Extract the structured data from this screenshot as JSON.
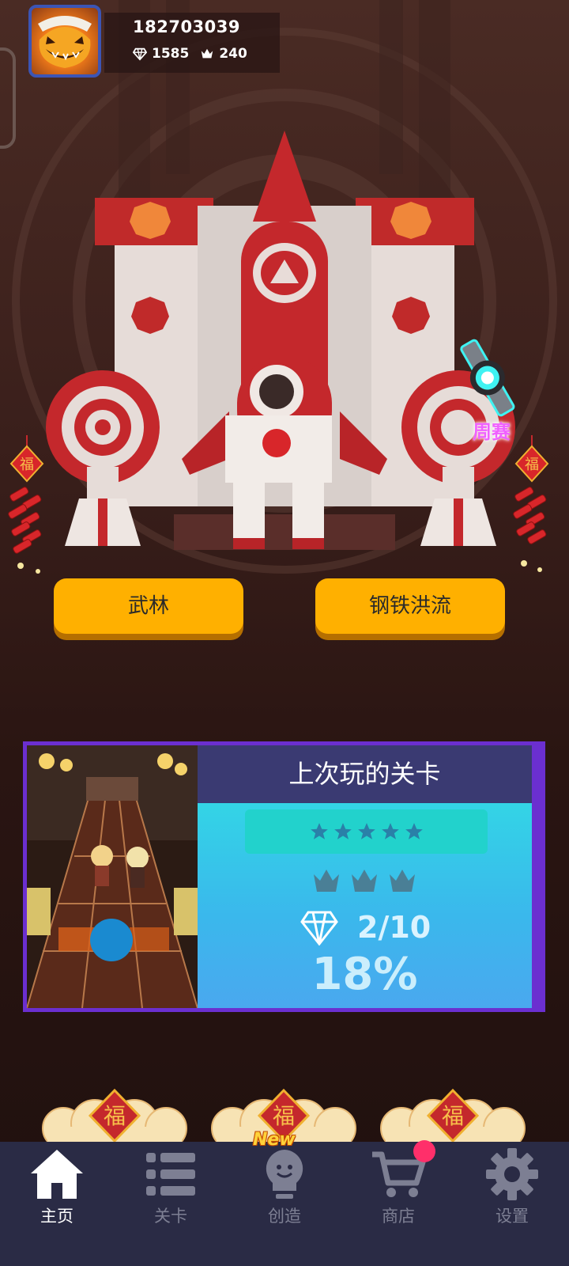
{
  "profile": {
    "user_id": "182703039",
    "diamonds": "1585",
    "crowns": "240",
    "avatar_icon": "pumpkin-avatar-icon"
  },
  "event": {
    "weekly_label": "周赛"
  },
  "modes": {
    "left_label": "武林",
    "right_label": "钢铁洪流"
  },
  "last_played": {
    "title": "上次玩的关卡",
    "stars_total": 5,
    "stars_earned": 0,
    "crowns_total": 3,
    "crowns_earned": 0,
    "gems": "2/10",
    "progress": "18%"
  },
  "badges": {
    "new_label": "New"
  },
  "nav": {
    "items": [
      {
        "label": "主页",
        "icon": "home-icon",
        "active": true
      },
      {
        "label": "关卡",
        "icon": "list-icon",
        "active": false
      },
      {
        "label": "创造",
        "icon": "bulb-icon",
        "active": false
      },
      {
        "label": "商店",
        "icon": "cart-icon",
        "active": false
      },
      {
        "label": "设置",
        "icon": "gear-icon",
        "active": false
      }
    ]
  },
  "colors": {
    "button_yellow": "#ffb000",
    "card_border": "#6b2fd0",
    "card_header": "#3a3a72",
    "nav_bg": "#2a2b45",
    "weekly_text": "#f061ff",
    "notification": "#ff2f6a"
  }
}
